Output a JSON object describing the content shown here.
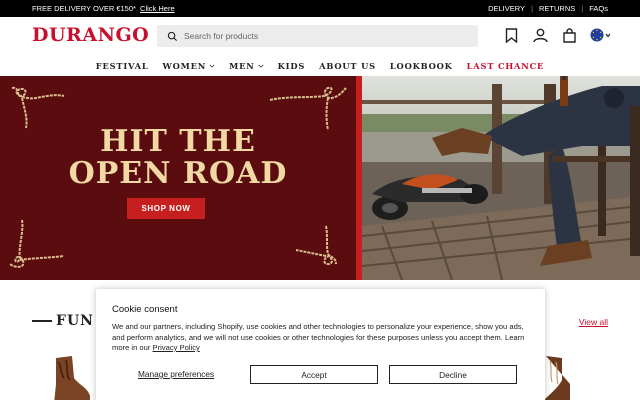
{
  "announcement": {
    "promo": "FREE DELIVERY OVER €150*",
    "promo_link": "Click Here",
    "links": [
      "DELIVERY",
      "RETURNS",
      "FAQs"
    ]
  },
  "header": {
    "logo": "DURANGO",
    "search_placeholder": "Search for products",
    "icons": [
      "bookmark-icon",
      "account-icon",
      "cart-icon",
      "eu-flag-icon"
    ]
  },
  "nav": {
    "items": [
      {
        "label": "FESTIVAL",
        "dropdown": false
      },
      {
        "label": "WOMEN",
        "dropdown": true
      },
      {
        "label": "MEN",
        "dropdown": true
      },
      {
        "label": "KIDS",
        "dropdown": false
      },
      {
        "label": "ABOUT US",
        "dropdown": false
      },
      {
        "label": "LOOKBOOK",
        "dropdown": false
      },
      {
        "label": "LAST CHANCE",
        "dropdown": false
      }
    ]
  },
  "hero": {
    "title_line1": "HIT THE",
    "title_line2": "OPEN ROAD",
    "cta": "SHOP NOW"
  },
  "section": {
    "title": "FUN",
    "view_all": "View all"
  },
  "cookie": {
    "title": "Cookie consent",
    "body": "We and our partners, including Shopify, use cookies and other technologies to personalize your experience, show you ads, and perform analytics, and we will not use cookies or other technologies for these purposes unless you accept them. Learn more in our ",
    "policy_link": "Privacy Policy",
    "manage": "Manage preferences",
    "accept": "Accept",
    "decline": "Decline"
  },
  "colors": {
    "brand_red": "#c8102e",
    "hero_maroon": "#5a0c0e",
    "hero_gold": "#f2d9a4"
  }
}
